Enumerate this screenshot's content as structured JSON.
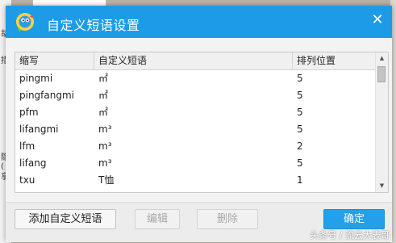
{
  "colors": {
    "titlebar": "#1e9be6",
    "primary_button": "#24a0ea"
  },
  "background_app": {
    "left_fragments": [
      "胡",
      "措",
      "隐(",
      "享"
    ]
  },
  "dialog": {
    "title": "自定义短语设置",
    "icon": "app-logo-icon",
    "close_icon": "close-icon",
    "close_glyph": "✕"
  },
  "table": {
    "columns": [
      "缩写",
      "自定义短语",
      "排列位置"
    ],
    "rows": [
      {
        "abbr": "pingmi",
        "phrase": "㎡",
        "position": "5"
      },
      {
        "abbr": "pingfangmi",
        "phrase": "㎡",
        "position": "5"
      },
      {
        "abbr": "pfm",
        "phrase": "㎡",
        "position": "5"
      },
      {
        "abbr": "lifangmi",
        "phrase": "m³",
        "position": "5"
      },
      {
        "abbr": "lfm",
        "phrase": "m³",
        "position": "2"
      },
      {
        "abbr": "lifang",
        "phrase": "m³",
        "position": "5"
      },
      {
        "abbr": "txu",
        "phrase": "T恤",
        "position": "1"
      }
    ],
    "scroll_up_icon": "scroll-up-icon",
    "scroll_down_icon": "scroll-down-icon"
  },
  "buttons": {
    "add": "添加自定义短语",
    "edit": "编辑",
    "delete": "删除",
    "confirm": "确定"
  },
  "watermark": "头条号 / 流云大表哥"
}
